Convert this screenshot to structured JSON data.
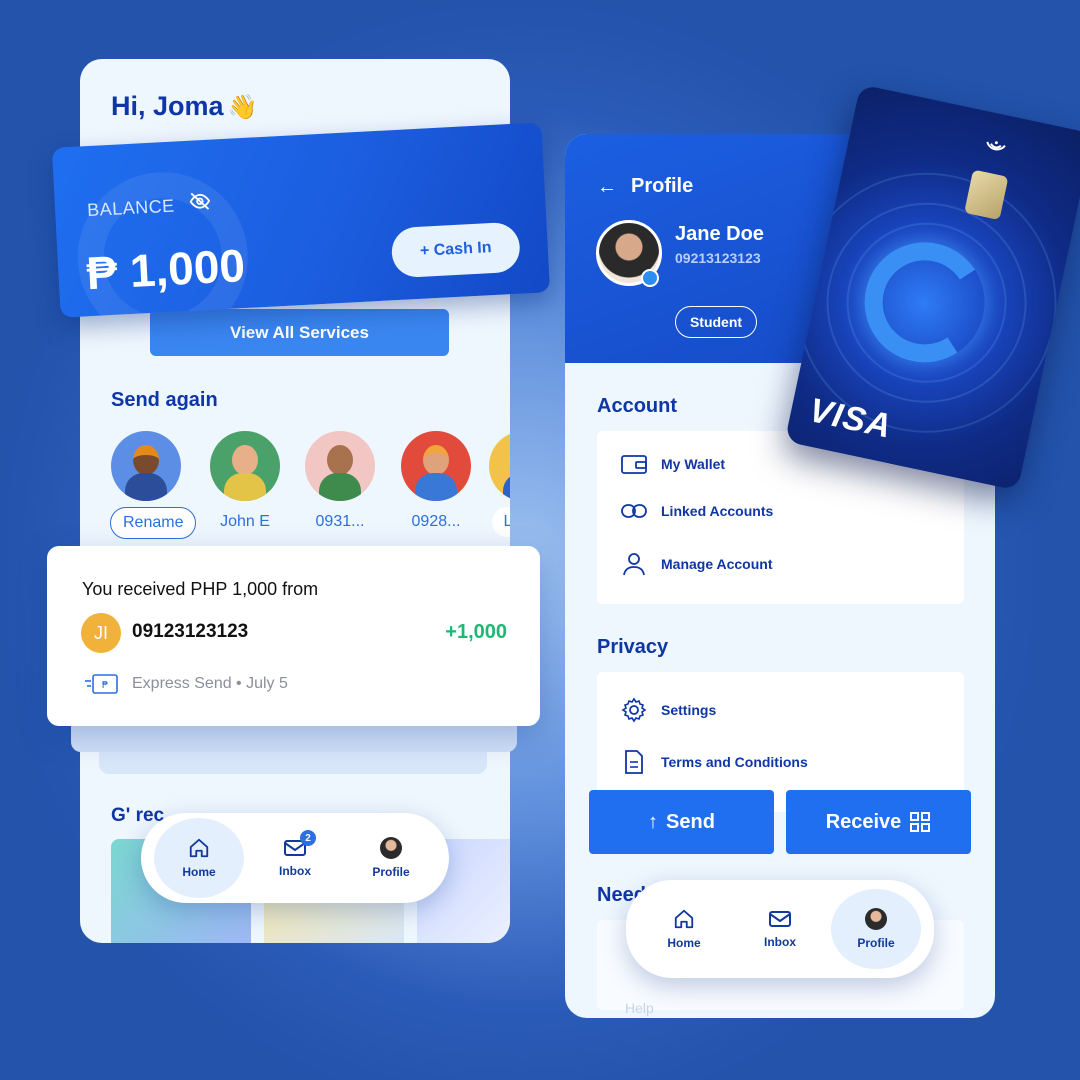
{
  "left_screen": {
    "greeting": "Hi, Joma",
    "greeting_emoji": "👋",
    "balance": {
      "label": "BALANCE",
      "amount": "₱ 1,000",
      "cash_in_label": "+ Cash In"
    },
    "view_all_services": "View All Services",
    "send_again": {
      "title": "Send again",
      "contacts": [
        {
          "label": "Rename"
        },
        {
          "label": "John E"
        },
        {
          "label": "0931..."
        },
        {
          "label": "0928..."
        },
        {
          "label": "Les E"
        }
      ]
    },
    "notification": {
      "title": "You received PHP 1,000 from",
      "initials": "JI",
      "number": "09123123123",
      "amount": "+1,000",
      "meta": "Express Send • July 5"
    },
    "recommendations_title": "G' rec",
    "nav": {
      "items": [
        {
          "label": "Home",
          "icon": "home-icon",
          "active": true
        },
        {
          "label": "Inbox",
          "icon": "inbox-icon",
          "badge": "2"
        },
        {
          "label": "Profile",
          "icon": "profile-avatar"
        }
      ]
    }
  },
  "right_screen": {
    "title": "Profile",
    "user": {
      "name": "Jane Doe",
      "phone": "09213123123",
      "tag": "Student"
    },
    "account": {
      "title": "Account",
      "items": [
        {
          "label": "My Wallet",
          "icon": "wallet-icon"
        },
        {
          "label": "Linked Accounts",
          "icon": "link-icon"
        },
        {
          "label": "Manage Account",
          "icon": "user-icon"
        }
      ]
    },
    "privacy": {
      "title": "Privacy",
      "items": [
        {
          "label": "Settings",
          "icon": "gear-icon"
        },
        {
          "label": "Terms and Conditions",
          "icon": "document-icon"
        }
      ]
    },
    "actions": {
      "send": "Send",
      "receive": "Receive"
    },
    "need_help_title": "Need",
    "help_label": "Help",
    "nav": {
      "items": [
        {
          "label": "Home",
          "icon": "home-icon"
        },
        {
          "label": "Inbox",
          "icon": "inbox-icon"
        },
        {
          "label": "Profile",
          "icon": "profile-avatar",
          "active": true
        }
      ]
    }
  },
  "card": {
    "brand": "VISA"
  },
  "colors": {
    "brand_blue": "#1f6ff0",
    "heading_blue": "#0f36a6",
    "success_green": "#22b573",
    "background": "#2a5bb8"
  }
}
